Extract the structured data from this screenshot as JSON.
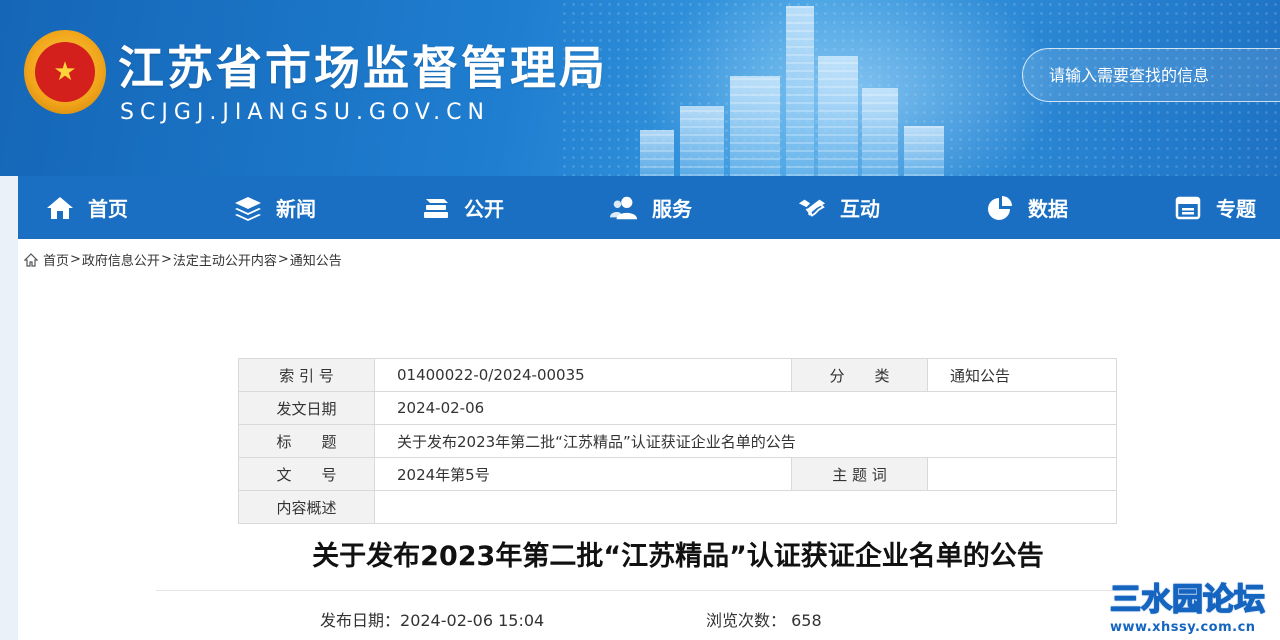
{
  "header": {
    "site_title": "江苏省市场监督管理局",
    "site_domain": "SCJGJ.JIANGSU.GOV.CN",
    "search_placeholder": "请输入需要查找的信息"
  },
  "nav": [
    {
      "label": "首页",
      "icon": "home-icon"
    },
    {
      "label": "新闻",
      "icon": "layers-icon"
    },
    {
      "label": "公开",
      "icon": "book-stack-icon"
    },
    {
      "label": "服务",
      "icon": "users-icon"
    },
    {
      "label": "互动",
      "icon": "handshake-icon"
    },
    {
      "label": "数据",
      "icon": "pie-chart-icon"
    },
    {
      "label": "专题",
      "icon": "window-icon"
    }
  ],
  "breadcrumb": [
    "首页",
    "政府信息公开",
    "法定主动公开内容",
    "通知公告"
  ],
  "breadcrumb_sep": ">",
  "info": {
    "index_label": "索 引 号",
    "index_value": "01400022-0/2024-00035",
    "category_label": "分　　类",
    "category_value": "通知公告",
    "date_label": "发文日期",
    "date_value": "2024-02-06",
    "title_label": "标　　题",
    "title_value": "关于发布2023年第二批“江苏精品”认证获证企业名单的公告",
    "doc_no_label": "文　　号",
    "doc_no_value": "2024年第5号",
    "keywords_label": "主 题 词",
    "keywords_value": "",
    "summary_label": "内容概述",
    "summary_value": ""
  },
  "article": {
    "title": "关于发布2023年第二批“江苏精品”认证获证企业名单的公告",
    "publish_label": "发布日期：",
    "publish_value": "2024-02-06 15:04",
    "views_label": "浏览次数：",
    "views_value": "658"
  },
  "watermark": {
    "main": "三水园论坛",
    "sub": "www.xhssy.com.cn"
  },
  "colors": {
    "nav_bg": "#1a6fc3",
    "header_bg": "#1f7ed0",
    "watermark": "#1565c0"
  }
}
